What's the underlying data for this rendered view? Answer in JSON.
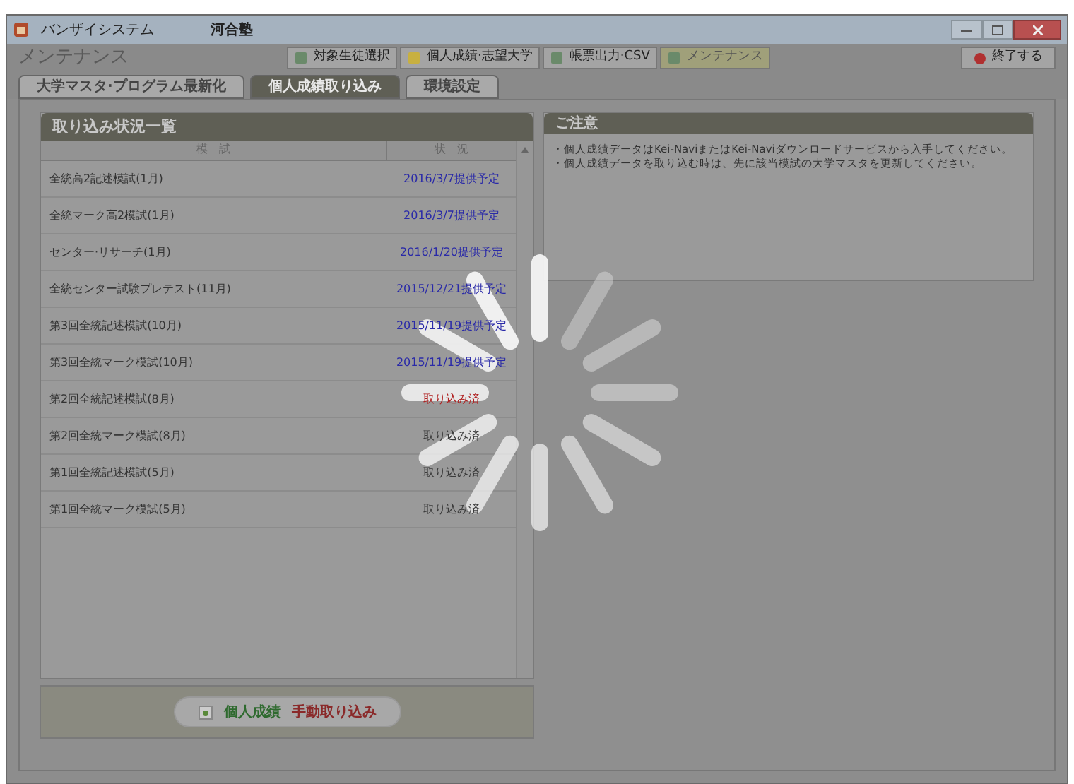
{
  "window": {
    "title": "バンザイシステム",
    "subtitle": "河合塾"
  },
  "toolbar": {
    "section_title": "メンテナンス",
    "buttons": [
      {
        "label": "対象生徒選択",
        "selected": false
      },
      {
        "label": "個人成績·志望大学",
        "selected": false
      },
      {
        "label": "帳票出力·CSV",
        "selected": false
      },
      {
        "label": "メンテナンス",
        "selected": true
      }
    ],
    "exit_button": "終了する"
  },
  "tabs": [
    {
      "label": "大学マスタ·プログラム最新化",
      "selected": false
    },
    {
      "label": "個人成績取り込み",
      "selected": true
    },
    {
      "label": "環境設定",
      "selected": false
    }
  ],
  "import_status": {
    "title": "取り込み状況一覧",
    "columns": [
      "模　試",
      "状　況"
    ],
    "rows": [
      {
        "exam": "全統高2記述模試(1月)",
        "status": "2016/3/7提供予定",
        "kind": "scheduled"
      },
      {
        "exam": "全統マーク高2模試(1月)",
        "status": "2016/3/7提供予定",
        "kind": "scheduled"
      },
      {
        "exam": "センター·リサーチ(1月)",
        "status": "2016/1/20提供予定",
        "kind": "scheduled"
      },
      {
        "exam": "全統センター試験プレテスト(11月)",
        "status": "2015/12/21提供予定",
        "kind": "scheduled"
      },
      {
        "exam": "第3回全統記述模試(10月)",
        "status": "2015/11/19提供予定",
        "kind": "scheduled"
      },
      {
        "exam": "第3回全統マーク模試(10月)",
        "status": "2015/11/19提供予定",
        "kind": "scheduled"
      },
      {
        "exam": "第2回全統記述模試(8月)",
        "status": "取り込み済",
        "kind": "new"
      },
      {
        "exam": "第2回全統マーク模試(8月)",
        "status": "取り込み済",
        "kind": "done"
      },
      {
        "exam": "第1回全統記述模試(5月)",
        "status": "取り込み済",
        "kind": "done"
      },
      {
        "exam": "第1回全統マーク模試(5月)",
        "status": "取り込み済",
        "kind": "done"
      }
    ],
    "manual_button": {
      "label_part_1": "個人成績",
      "label_part_2": "手動取り込み"
    }
  },
  "notice": {
    "title": "ご注意",
    "lines": [
      "・個人成績データはKei-NaviまたはKei-Naviダウンロードサービスから入手してください。",
      "・個人成績データを取り込む時は、先に該当模試の大学マスタを更新してください。"
    ]
  }
}
